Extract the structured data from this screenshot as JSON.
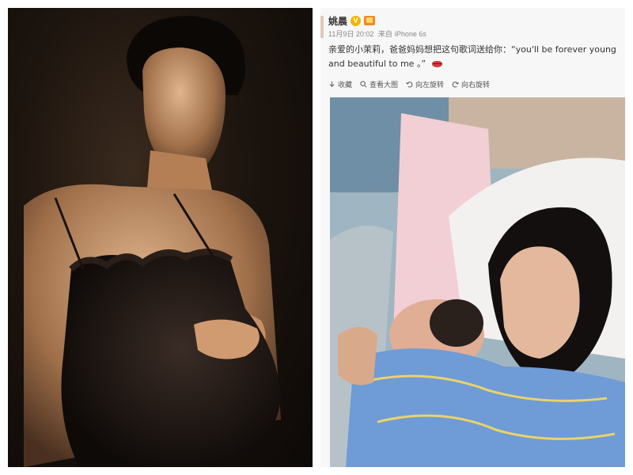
{
  "post": {
    "author": "姚晨",
    "date": "11月9日 20:02",
    "source_prefix": "来自",
    "source": "iPhone 6s",
    "text": "亲爱的小茉莉，爸爸妈妈想把这句歌词送给你：“you'll be forever young and beautiful to me 。”"
  },
  "toolbar": {
    "collect": "收藏",
    "view_large": "查看大图",
    "rotate_left": "向左旋转",
    "rotate_right": "向右旋转"
  },
  "icons": {
    "verified": "verified-v-badge",
    "member": "member-crown-badge",
    "emoji": "lips-icon"
  },
  "colors": {
    "verified_badge": "#f5b400",
    "member_badge": "#f08a24",
    "panel_bg": "#f7f7f7"
  }
}
